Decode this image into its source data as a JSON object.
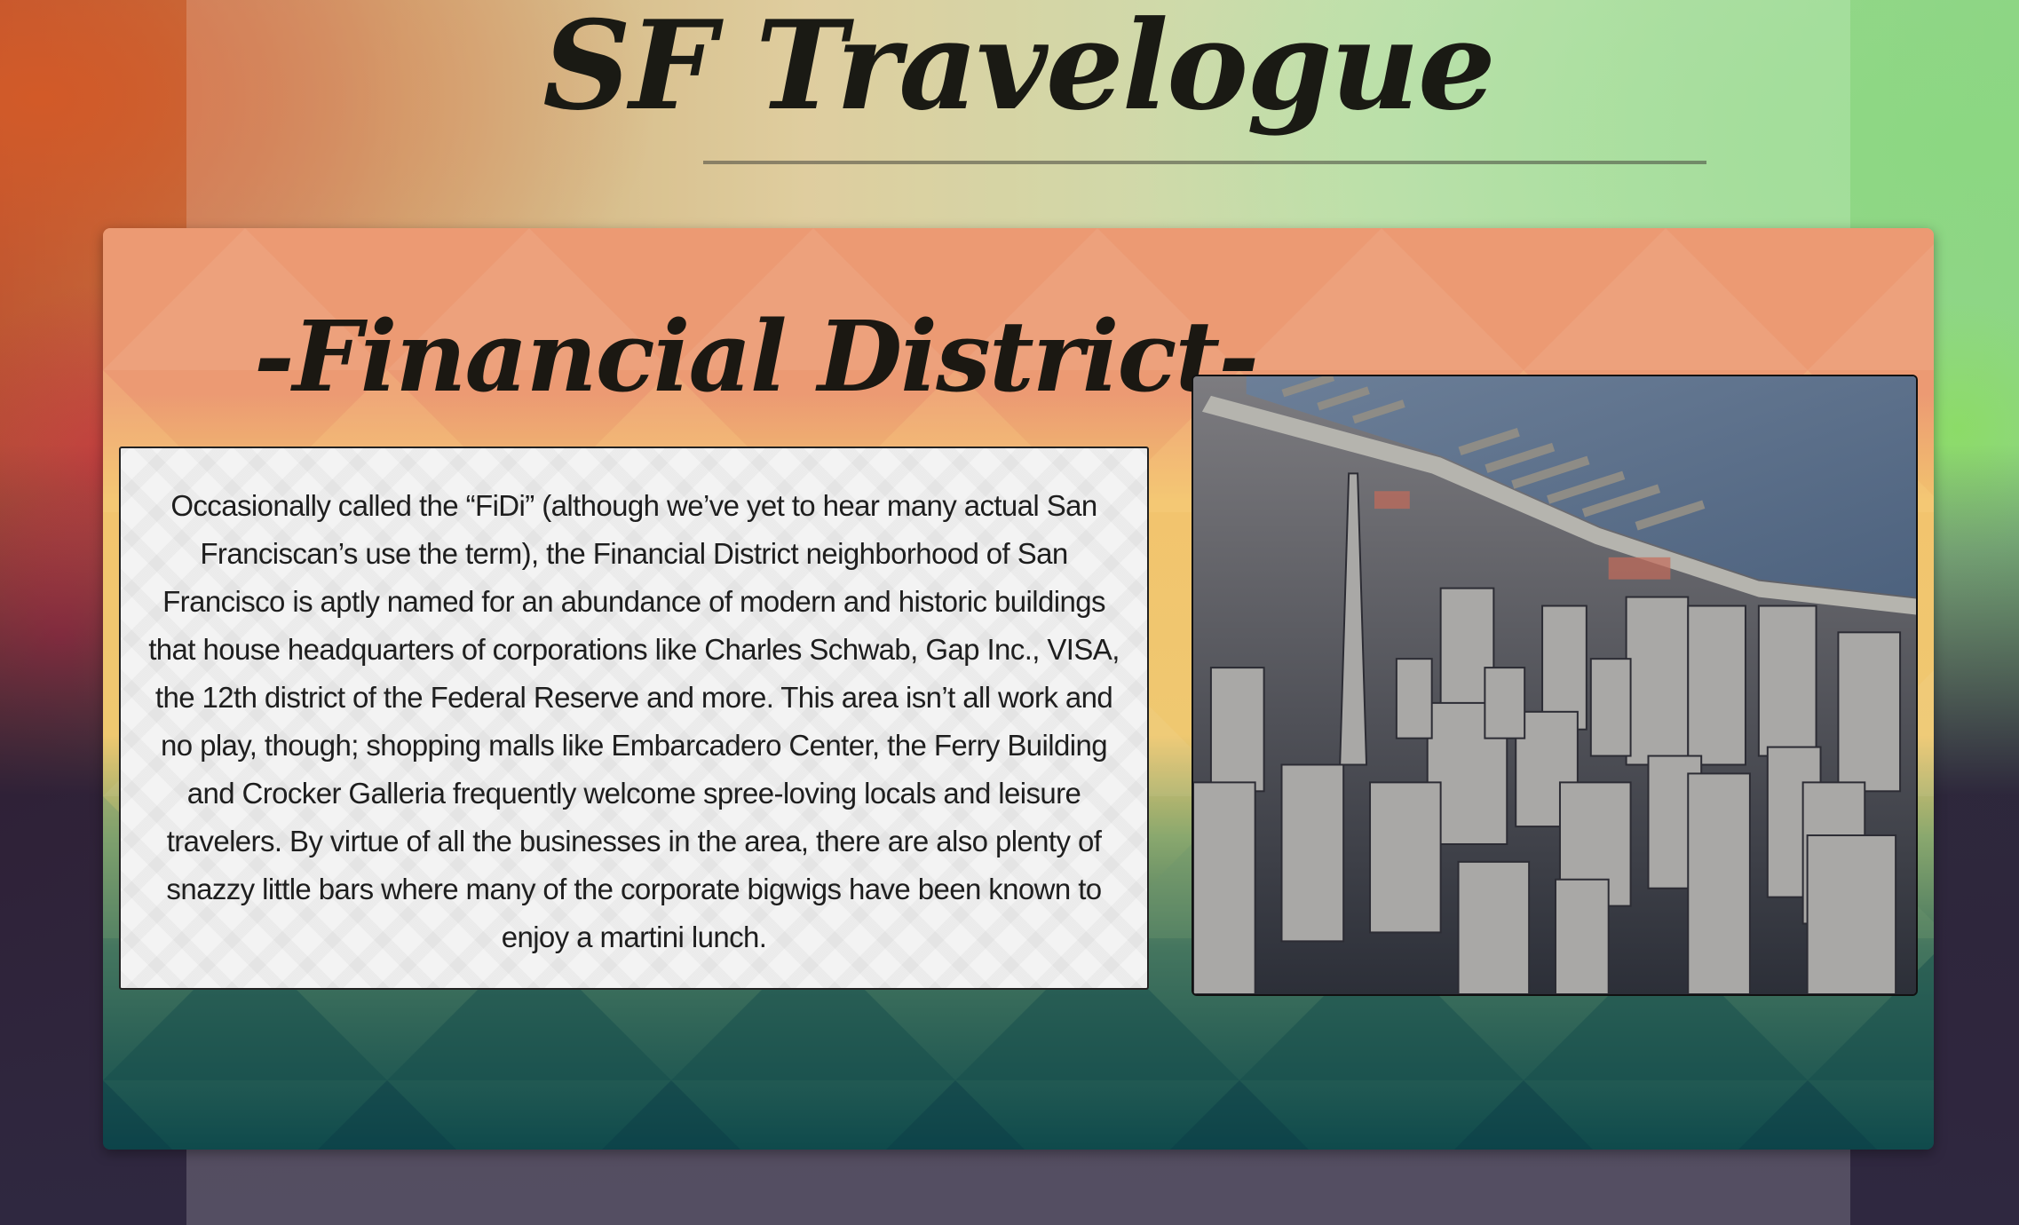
{
  "page": {
    "site_title": "SF Travelogue"
  },
  "section": {
    "heading": "-Financial District-",
    "body": "Occasionally called the “FiDi” (although we’ve yet to hear many actual San Franciscan’s use the term), the Financial District neighborhood of San Francisco is aptly named for an abundance of modern and historic buildings that house headquarters of corporations like Charles Schwab, Gap Inc., VISA, the 12th district of the Federal Reserve and more. This area isn’t all work and no play, though; shopping malls like Embarcadero Center, the Ferry Building and Crocker Galleria frequently welcome spree-loving locals and leisure travelers. By virtue of all the businesses in the area, there are also plenty of snazzy little bars where many of the corporate bigwigs have been known to enjoy a martini lunch.",
    "photo_subject": "aerial-view-financial-district-skyline"
  },
  "colors": {
    "card_top": "#ea9a72",
    "card_mid": "#f0c870",
    "card_low": "#8aa86e",
    "card_bottom": "#0f4a4c",
    "text_dark": "#1b1812"
  }
}
